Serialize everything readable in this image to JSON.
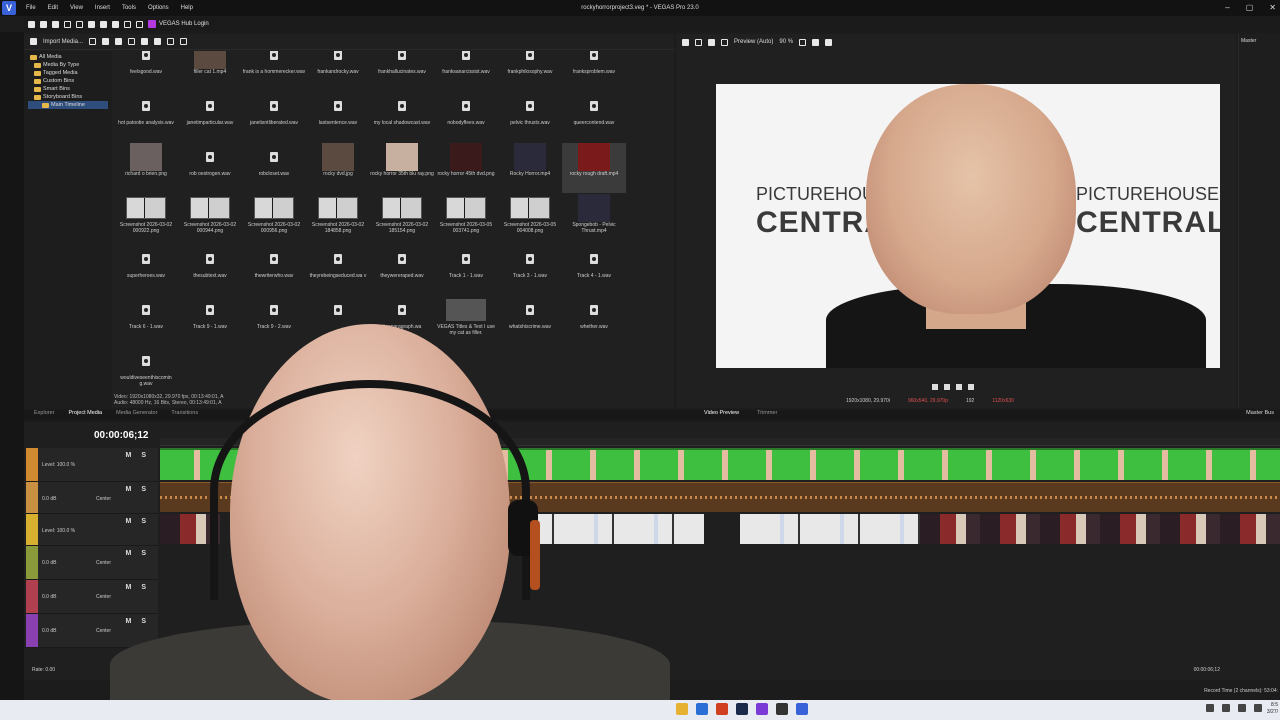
{
  "window": {
    "title": "rockyhorrorproject3.veg * - VEGAS Pro 23.0",
    "app_logo": "V"
  },
  "menu": [
    "File",
    "Edit",
    "View",
    "Insert",
    "Tools",
    "Options",
    "Help"
  ],
  "toolbar": {
    "hub_label": "VEGAS Hub Login"
  },
  "media": {
    "import_label": "Import Media...",
    "tree": [
      "All Media",
      "Media By Type",
      "Tagged Media",
      "Custom Bins",
      "Smart Bins",
      "Storyboard Bins",
      "Main Timeline"
    ],
    "tiles": [
      {
        "cap": "feelsgood.wav",
        "kind": "audio"
      },
      {
        "cap": "filler cat 1.mp4",
        "kind": "image"
      },
      {
        "cap": "frank is a hommerecker.wav",
        "kind": "audio"
      },
      {
        "cap": "frankandrocky.wav",
        "kind": "audio"
      },
      {
        "cap": "frankhallucinates.wav",
        "kind": "audio"
      },
      {
        "cap": "franksanarcissist.wav",
        "kind": "audio"
      },
      {
        "cap": "frankphilosophy.wav",
        "kind": "audio"
      },
      {
        "cap": "franksproblem.wav",
        "kind": "audio"
      },
      {
        "cap": "hot patootie analysis.wav",
        "kind": "audio"
      },
      {
        "cap": "janetimparticular.wav",
        "kind": "audio"
      },
      {
        "cap": "janetisntliberated.wav",
        "kind": "audio"
      },
      {
        "cap": "lastsentence.wav",
        "kind": "audio"
      },
      {
        "cap": "my local shadowcast.wav",
        "kind": "audio"
      },
      {
        "cap": "nobodyflees.wav",
        "kind": "audio"
      },
      {
        "cap": "pelvic thrusts.wav",
        "kind": "audio"
      },
      {
        "cap": "queercontend.wav",
        "kind": "audio"
      },
      {
        "cap": "richard o brien.png",
        "kind": "image"
      },
      {
        "cap": "rob oestrogen.wav",
        "kind": "audio"
      },
      {
        "cap": "robcloset.wav",
        "kind": "audio"
      },
      {
        "cap": "rocky dvd.jpg",
        "kind": "image"
      },
      {
        "cap": "rocky horror 35th blu ray.png",
        "kind": "image"
      },
      {
        "cap": "rocky horror 45th dvd.png",
        "kind": "image"
      },
      {
        "cap": "Rocky Horror.mp4",
        "kind": "image"
      },
      {
        "cap": "rocky rough draft.mp4",
        "kind": "image",
        "selected": true
      },
      {
        "cap": "Screenshot 2026-03-02 000922.png",
        "kind": "shot"
      },
      {
        "cap": "Screenshot 2026-03-02 000944.png",
        "kind": "shot"
      },
      {
        "cap": "Screenshot 2026-03-02 000956.png",
        "kind": "shot"
      },
      {
        "cap": "Screenshot 2026-03-02 184858.png",
        "kind": "shot"
      },
      {
        "cap": "Screenshot 2026-03-02 185154.png",
        "kind": "shot"
      },
      {
        "cap": "Screenshot 2026-03-05 003741.png",
        "kind": "shot"
      },
      {
        "cap": "Screenshot 2026-03-05 004008.png",
        "kind": "shot"
      },
      {
        "cap": "Spongebob - Pelvic Thrust.mp4",
        "kind": "image"
      },
      {
        "cap": "superheroes.wav",
        "kind": "audio"
      },
      {
        "cap": "thesubtext.wav",
        "kind": "audio"
      },
      {
        "cap": "thewriterwho.wav",
        "kind": "audio"
      },
      {
        "cap": "theyrebeingseduced.wa v",
        "kind": "audio"
      },
      {
        "cap": "theywereraped.wav",
        "kind": "audio"
      },
      {
        "cap": "Track 1 - 1.wav",
        "kind": "audio"
      },
      {
        "cap": "Track 3 - 1.wav",
        "kind": "audio"
      },
      {
        "cap": "Track 4 - 1.wav",
        "kind": "audio"
      },
      {
        "cap": "Track 6 - 1.wav",
        "kind": "audio"
      },
      {
        "cap": "Track 9 - 1.wav",
        "kind": "audio"
      },
      {
        "cap": "Track 9 - 2.wav",
        "kind": "audio"
      },
      {
        "cap": "",
        "kind": "audio"
      },
      {
        "cap": "tionparagraph.wa",
        "kind": "audio"
      },
      {
        "cap": "VEGAS Titles & Text I use my cat as filler.",
        "kind": "title"
      },
      {
        "cap": "whatshiscrime.wav",
        "kind": "audio"
      },
      {
        "cap": "whether.wav",
        "kind": "audio"
      },
      {
        "cap": "wouldiveseenthiscomin g.wav",
        "kind": "audio"
      }
    ],
    "info_line1": "Video: 1920x1080x32, 29.970 fps, 00:13:49:01, A",
    "info_line2": "Audio: 48000 Hz, 16 Bits, Stereo, 00:13:49:01, A"
  },
  "preview": {
    "mode": "Preview (Auto)",
    "zoom": "90 %",
    "banner_small": "PICTUREHOUSE",
    "banner_big": "CENTRAL",
    "status_project": "1920x1080, 29.970i",
    "status_preview": "960x540, 29.970p",
    "status_frame": "192",
    "status_display": "1120x630",
    "master_label": "Master"
  },
  "tabs": {
    "left": [
      "Explorer",
      "Project Media",
      "Media Generator",
      "Transitions"
    ],
    "right": [
      "Video Preview",
      "Trimmer"
    ],
    "master_bus": "Master Bus"
  },
  "timeline": {
    "timecode": "00:00:06;12",
    "tracks": [
      {
        "level": "Level: 100.0 %",
        "color": "#d08a30",
        "type": "video"
      },
      {
        "level": "0.0 dB",
        "center": "Center",
        "color": "#c89040",
        "type": "audio"
      },
      {
        "level": "Level: 100.0 %",
        "color": "#d8b030",
        "type": "video"
      },
      {
        "level": "0.0 dB",
        "center": "Center",
        "color": "#8a9a3a",
        "type": "audio"
      },
      {
        "level": "0.0 dB",
        "center": "Center",
        "color": "#b04050",
        "type": "audio"
      },
      {
        "level": "0.0 dB",
        "center": "Center",
        "color": "#8a40b0",
        "type": "audio"
      }
    ],
    "ms_label": "M S",
    "rate": "Rate: 0.00",
    "cursor_time": "00:00:06;12",
    "record_time": "Record Time (2 channels): 53:04:"
  },
  "taskbar": {
    "clock_time": "8:5",
    "clock_date": "3/27/"
  }
}
